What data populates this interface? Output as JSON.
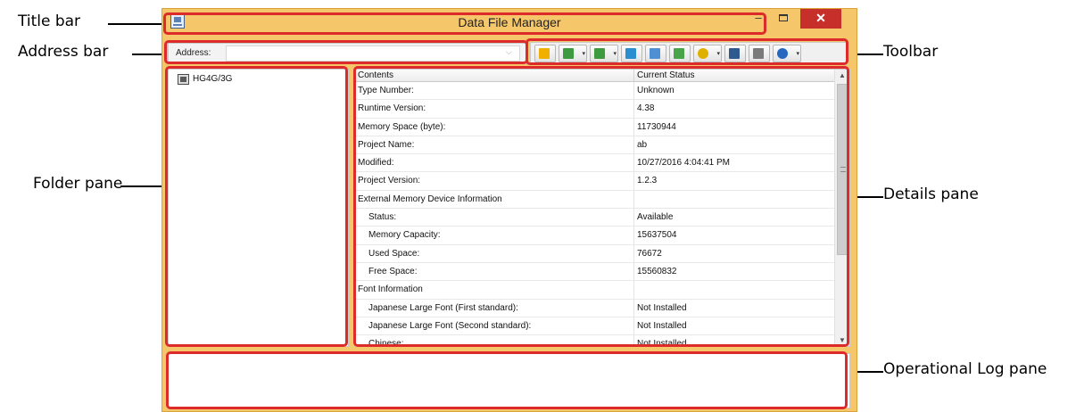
{
  "window": {
    "title": "Data File Manager",
    "controls": {
      "minimize": "–",
      "close": "✕"
    }
  },
  "address_bar": {
    "label": "Address:",
    "value": "",
    "dropdown_icon": "⌵"
  },
  "toolbar": {
    "buttons": [
      {
        "name": "lightning-icon",
        "color": "#f0b000",
        "dropdown": false
      },
      {
        "name": "image-icon",
        "color": "#3e9a3e",
        "dropdown": true
      },
      {
        "name": "image-settings-icon",
        "color": "#3e9a3e",
        "dropdown": true
      },
      {
        "name": "page-export-icon",
        "color": "#2a8ed0",
        "dropdown": false
      },
      {
        "name": "download-icon",
        "color": "#4f8fd3",
        "dropdown": false
      },
      {
        "name": "upload-icon",
        "color": "#4aa54a",
        "dropdown": false
      },
      {
        "name": "storage-icon",
        "color": "#e0b000",
        "dropdown": true
      },
      {
        "name": "check-document-icon",
        "color": "#2f5a8f",
        "dropdown": false
      },
      {
        "name": "document-icon",
        "color": "#7a7a7a",
        "dropdown": false
      },
      {
        "name": "help-icon",
        "color": "#2468c0",
        "dropdown": true
      }
    ],
    "dropdown_glyph": "▾"
  },
  "folder_pane": {
    "items": [
      {
        "label": "HG4G/3G"
      }
    ]
  },
  "details_pane": {
    "columns": [
      "Contents",
      "Current Status"
    ],
    "rows": [
      {
        "content": "Type Number:",
        "status": "Unknown",
        "indent": false
      },
      {
        "content": "Runtime Version:",
        "status": "4.38",
        "indent": false
      },
      {
        "content": "Memory Space (byte):",
        "status": "11730944",
        "indent": false
      },
      {
        "content": "Project Name:",
        "status": "ab",
        "indent": false
      },
      {
        "content": "Modified:",
        "status": "10/27/2016 4:04:41 PM",
        "indent": false
      },
      {
        "content": "Project Version:",
        "status": "1.2.3",
        "indent": false
      },
      {
        "content": "External Memory Device Information",
        "status": "",
        "indent": false
      },
      {
        "content": "Status:",
        "status": "Available",
        "indent": true
      },
      {
        "content": "Memory Capacity:",
        "status": "15637504",
        "indent": true
      },
      {
        "content": "Used Space:",
        "status": "76672",
        "indent": true
      },
      {
        "content": "Free Space:",
        "status": "15560832",
        "indent": true
      },
      {
        "content": "Font Information",
        "status": "",
        "indent": false
      },
      {
        "content": "Japanese Large Font (First standard):",
        "status": "Not Installed",
        "indent": true
      },
      {
        "content": "Japanese Large Font (Second standard):",
        "status": "Not Installed",
        "indent": true
      },
      {
        "content": "Chinese:",
        "status": "Not Installed",
        "indent": true
      }
    ],
    "scroll_up": "▲",
    "scroll_down": "▼"
  },
  "log_pane": {
    "text": ""
  },
  "callouts": {
    "title_bar": "Title bar",
    "address_bar": "Address bar",
    "folder_pane": "Folder pane",
    "toolbar": "Toolbar",
    "details_pane": "Details pane",
    "log_pane": "Operational Log pane"
  },
  "colors": {
    "highlight": "#dd2a2a",
    "window_frame": "#f5c66a",
    "close_button": "#c7302a"
  }
}
